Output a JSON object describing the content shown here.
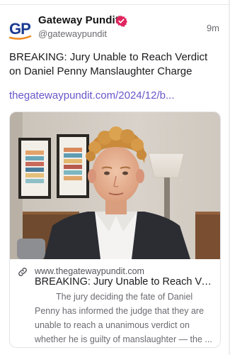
{
  "post": {
    "author": {
      "name": "Gateway Pundit",
      "handle": "@gatewaypundit",
      "avatar_text": "GP",
      "verified_icon": "verified-badge-icon"
    },
    "timestamp": "9m",
    "text": "BREAKING: Jury Unable to Reach Verdict on Daniel Penny Manslaughter Charge",
    "link_text": "thegatewaypundit.com/2024/12/b...",
    "link_card": {
      "image_description_icon": "video-still-thumbnail",
      "link_icon": "link-icon",
      "domain": "www.thegatewaypundit.com",
      "title": "BREAKING: Jury Unable to Reach Ver...",
      "description": "The jury deciding the fate of Daniel Penny has informed the judge that they are unable to reach a unanimous verdict on whether he is guilty of manslaughter — the ..."
    }
  },
  "colors": {
    "accent": "#6a55c9",
    "verified": "#e0245e",
    "brand_blue": "#1a3a8f",
    "brand_orange": "#f08a1c"
  }
}
